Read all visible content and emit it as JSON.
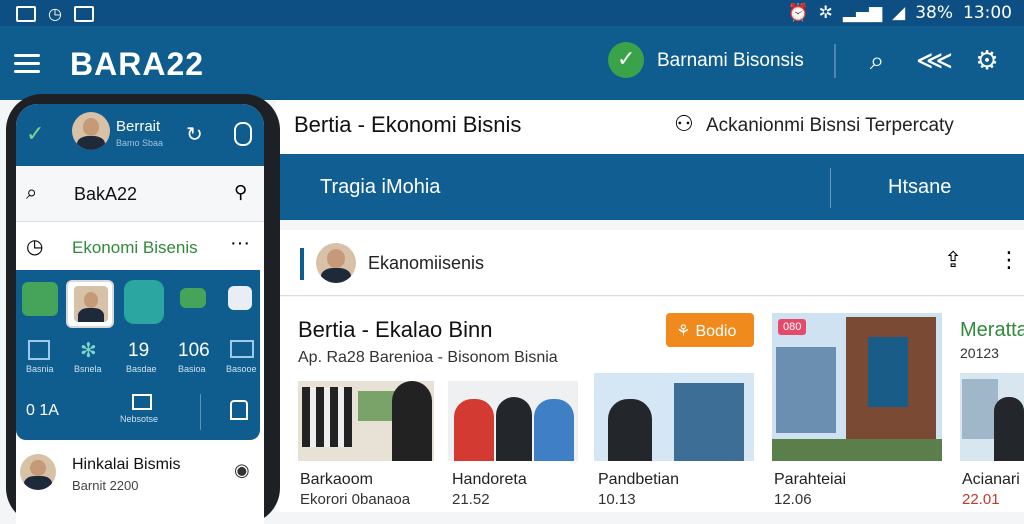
{
  "status_bar": {
    "battery": "38%",
    "time": "13:00"
  },
  "app_bar": {
    "title": "BARA22",
    "brand": "Barnami Bisonsis"
  },
  "sub_header": {
    "title": "Bertia - Ekonomi Bisnis",
    "account_text": "Ackanionmi Bisnsi Terpercaty"
  },
  "tabs": [
    {
      "label": "Tragia iMohia"
    },
    {
      "label": "Htsane"
    }
  ],
  "category_card": {
    "label": "Ekanomiisenis"
  },
  "article": {
    "headline": "Bertia - Ekalao Binn",
    "subline": "Ap. Ra28 Barenioa - Bisonom Bisnia",
    "button_label": "Bodio",
    "side_title": "Meratta",
    "side_date": "20123",
    "cards": [
      {
        "title": "Barkaoom",
        "meta": "Ekorori 0banaoa"
      },
      {
        "title": "Handoreta",
        "meta": "21.52"
      },
      {
        "title": "Pandbetian",
        "meta": "10.13"
      },
      {
        "title": "Parahteiai",
        "meta": "12.06"
      },
      {
        "title": "Acianari",
        "meta": "22.01"
      }
    ],
    "badge": "080"
  },
  "phone": {
    "header_name": "Berrait",
    "header_sub": "Bamo Sbaa",
    "search_text": "BakA22",
    "section_label": "Ekonomi Bisenis",
    "grid_numbers": [
      "19",
      "106",
      "0 1A"
    ],
    "grid_labels": [
      "Basnia",
      "Bsnela",
      "Basdae",
      "Basioa",
      "Basooe",
      "Nebsotse"
    ],
    "item_title": "Hinkalai Bismis",
    "item_sub": "Barnit 2200"
  },
  "colors": {
    "primary": "#0f5c8f",
    "accent": "#f08a1c",
    "green": "#3aa34a"
  }
}
